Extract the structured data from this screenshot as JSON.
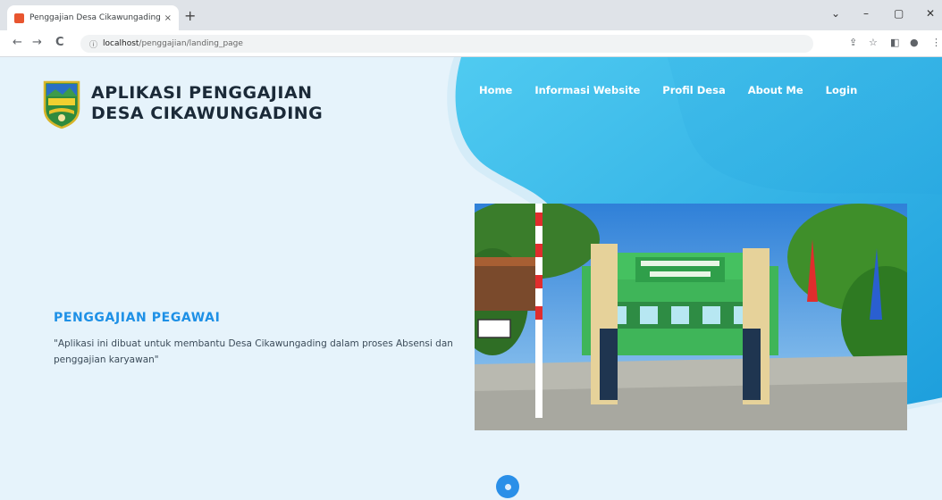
{
  "browser": {
    "tab_title": "Penggajian Desa Cikawungading",
    "tab_close": "×",
    "new_tab": "+",
    "url_host": "localhost",
    "url_path": "/penggajian/landing_page",
    "back": "←",
    "forward": "→",
    "reload": "C",
    "info": "ⓘ"
  },
  "brand": {
    "line1": "APLIKASI PENGGAJIAN",
    "line2": "DESA CIKAWUNGADING"
  },
  "nav": {
    "items": [
      "Home",
      "Informasi Website",
      "Profil Desa",
      "About Me",
      "Login"
    ]
  },
  "hero": {
    "title": "PENGGAJIAN PEGAWAI",
    "description": "\"Aplikasi ini dibuat untuk membantu Desa Cikawungading dalam proses Absensi dan penggajian karyawan\""
  },
  "colors": {
    "accent": "#1e90e6",
    "blob_start": "#4fc8f0",
    "blob_end": "#1fa0dc",
    "page_bg": "#e6f3fb"
  },
  "icons": [
    "favicon-icon",
    "back-arrow-icon",
    "forward-arrow-icon",
    "reload-icon",
    "site-info-icon",
    "share-icon",
    "bookmark-star-icon",
    "sidebar-icon",
    "profile-icon",
    "scroll-down-icon"
  ]
}
